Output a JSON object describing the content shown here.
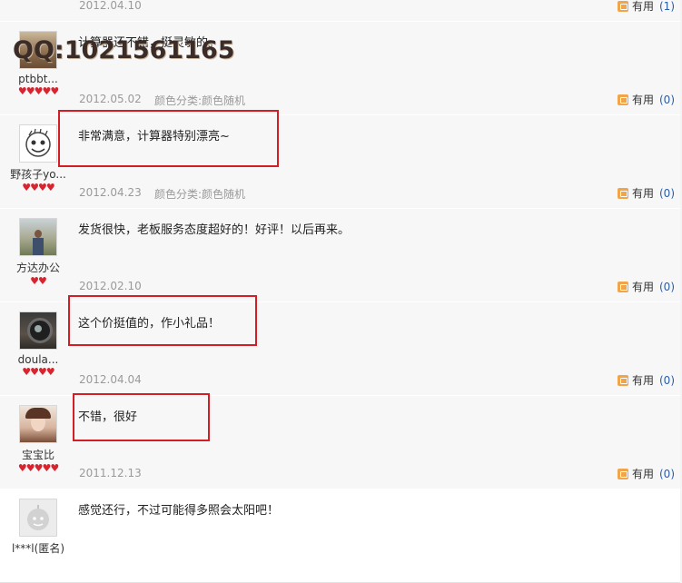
{
  "colors": {
    "highlight": "#d41e26",
    "heart": "#d8242f",
    "count": "#2a5ea8"
  },
  "useful_label": "有用",
  "top_row": {
    "date": "2012.04.10",
    "useful_count": "(1)"
  },
  "watermark": "QQ:1021561165",
  "reviews": [
    {
      "username": "ptbbt...",
      "comment": "计算器还不错，挺灵敏的。",
      "date": "2012.05.02",
      "color_category": "颜色分类:颜色随机",
      "hearts": 5,
      "useful_count": "(0)",
      "avatar_icon": "user-photo-icon"
    },
    {
      "username": "野孩子yo...",
      "comment": "非常满意，计算器特别漂亮~",
      "date": "2012.04.23",
      "color_category": "颜色分类:颜色随机",
      "hearts": 4,
      "useful_count": "(0)",
      "avatar_icon": "cartoon-face-icon"
    },
    {
      "username": "方达办公",
      "comment": "发货很快，老板服务态度超好的！好评！以后再来。",
      "date": "2012.02.10",
      "color_category": "",
      "hearts": 2,
      "useful_count": "(0)",
      "avatar_icon": "user-photo-icon"
    },
    {
      "username": "doula...",
      "comment": "这个价挺值的，作小礼品！",
      "date": "2012.04.04",
      "color_category": "",
      "hearts": 4,
      "useful_count": "(0)",
      "avatar_icon": "user-photo-icon"
    },
    {
      "username": "宝宝比",
      "comment": "不错，很好",
      "date": "2011.12.13",
      "color_category": "",
      "hearts": 5,
      "useful_count": "(0)",
      "avatar_icon": "user-photo-icon"
    },
    {
      "username": "l***l(匿名)",
      "comment": "感觉还行，不过可能得多照会太阳吧！",
      "date": "",
      "color_category": "",
      "hearts": 0,
      "useful_count": "",
      "avatar_icon": "anonymous-avatar-icon"
    }
  ]
}
